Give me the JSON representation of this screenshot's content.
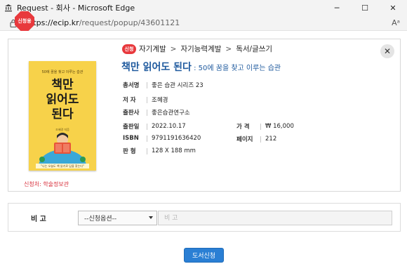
{
  "window": {
    "title": "Request - 회사 - Microsoft Edge",
    "url_host": "https://ecip.kr",
    "url_path": "/request/popup/43601121",
    "controls": {
      "minimize": "─",
      "maximize": "☐",
      "close": "✕"
    },
    "reader_glyph": "Aᵃ"
  },
  "popup": {
    "new_badge": "신청용",
    "close_glyph": "✕",
    "breadcrumb": {
      "badge": "신청",
      "items": [
        "자기계발",
        "자기능력계발",
        "독서/글쓰기"
      ],
      "separator": ">"
    },
    "book": {
      "title": "책만 읽어도 된다",
      "subtitle": " : 50에 꿈을 찾고 이루는 습관",
      "series_label": "총서명",
      "series": "좋은 습관 시리즈 23",
      "author_label": "저 자",
      "author": "조혜경",
      "publisher_label": "출판사",
      "publisher": "좋은습관연구소",
      "pub_date_label": "출판일",
      "pub_date": "2022.10.17",
      "price_label": "가 격",
      "price": "₩ 16,000",
      "isbn_label": "ISBN",
      "isbn": "9791191636420",
      "pages_label": "페이지",
      "pages": "212",
      "format_label": "판 형",
      "format": "128 X 188 mm"
    },
    "cover": {
      "subtitle": "50에 꿈을 찾고 이루는 습관",
      "title": "책만\n읽어도\n된다",
      "author": "조혜경 지음",
      "quote": "\"나는 오늘도 책 읽기로 답을 찾는다\""
    },
    "applicant": "신청처: 학술정보관"
  },
  "form": {
    "label": "비 고",
    "select_value": "--신청옵션--",
    "input_placeholder": "비 고",
    "submit_label": "도서신청"
  },
  "colors": {
    "accent_red": "#e8393d",
    "title_blue": "#1f5a9e",
    "button_blue": "#2a7fd4"
  }
}
